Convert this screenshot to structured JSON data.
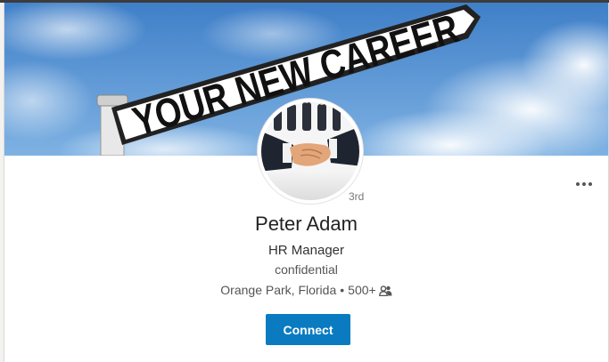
{
  "banner": {
    "sign_text": "YOUR NEW CAREER"
  },
  "profile": {
    "name": "Peter Adam",
    "headline": "HR Manager",
    "company": "confidential",
    "location": "Orange Park, Florida",
    "separator": "•",
    "connections": "500+",
    "degree": "3rd"
  },
  "actions": {
    "connect_label": "Connect",
    "more_icon": "ellipsis-icon"
  },
  "colors": {
    "accent": "#0a7bc1",
    "sky": "#4f8fd0"
  }
}
